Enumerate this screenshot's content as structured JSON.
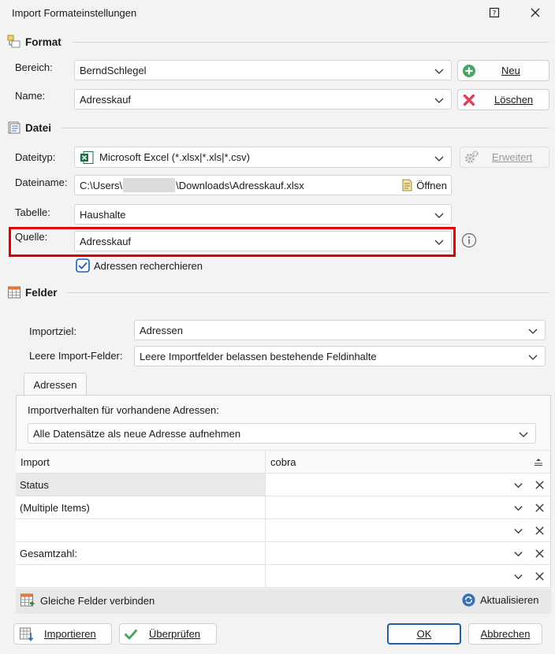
{
  "window": {
    "title": "Import Formateinstellungen"
  },
  "format": {
    "heading": "Format",
    "bereich_label": "Bereich:",
    "bereich_value": "BerndSchlegel",
    "name_label": "Name:",
    "name_value": "Adresskauf",
    "neu_button": "Neu",
    "loeschen_button": "Löschen"
  },
  "datei": {
    "heading": "Datei",
    "dateityp_label": "Dateityp:",
    "dateityp_value": "Microsoft Excel (*.xlsx|*.xls|*.csv)",
    "erweitert_button": "Erweitert",
    "dateiname_label": "Dateiname:",
    "dateiname_prefix": "C:\\Users\\",
    "dateiname_suffix": "\\Downloads\\Adresskauf.xlsx",
    "oeffnen_button": "Öffnen",
    "tabelle_label": "Tabelle:",
    "tabelle_value": "Haushalte",
    "quelle_label": "Quelle:",
    "quelle_value": "Adresskauf",
    "recherche_label": "Adressen recherchieren",
    "recherche_checked": true
  },
  "felder": {
    "heading": "Felder",
    "importziel_label": "Importziel:",
    "importziel_value": "Adressen",
    "leere_label": "Leere Import-Felder:",
    "leere_value": "Leere Importfelder belassen bestehende Feldinhalte",
    "tab_label": "Adressen",
    "verhalten_label": "Importverhalten für vorhandene Adressen:",
    "verhalten_value": "Alle Datensätze als neue Adresse aufnehmen",
    "grid": {
      "col_import": "Import",
      "col_cobra": "cobra",
      "rows": [
        {
          "import": "Status",
          "cobra": ""
        },
        {
          "import": "(Multiple Items)",
          "cobra": ""
        },
        {
          "import": "",
          "cobra": ""
        },
        {
          "import": "Gesamtzahl:",
          "cobra": ""
        },
        {
          "import": "",
          "cobra": ""
        }
      ]
    },
    "verbinden_label": "Gleiche Felder verbinden",
    "aktualisieren_label": "Aktualisieren"
  },
  "footer": {
    "importieren_button": "Importieren",
    "ueberpruefen_button": "Überprüfen",
    "ok_button": "OK",
    "abbrechen_button": "Abbrechen"
  },
  "colors": {
    "highlight_border": "#e00000",
    "accent_blue": "#1f5fa8",
    "checkbox_blue": "#1a5fb4",
    "excel_green": "#1d7044",
    "add_green": "#4aa564",
    "delete_red": "#e0405c"
  },
  "icons": [
    "format-icon",
    "datei-icon",
    "felder-icon",
    "help-icon",
    "close-icon",
    "add-icon",
    "delete-icon",
    "excel-icon",
    "gear-icon",
    "open-file-icon",
    "info-icon",
    "checkbox-icon",
    "sort-icon",
    "merge-fields-icon",
    "refresh-icon",
    "import-icon",
    "check-icon"
  ]
}
